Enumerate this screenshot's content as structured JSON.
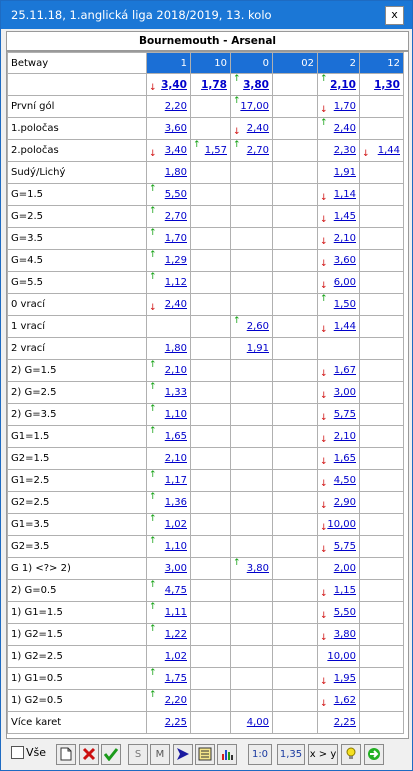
{
  "window": {
    "title": "25.11.18, 1.anglická liga 2018/2019, 13. kolo",
    "close_label": "x"
  },
  "match": "Bournemouth - Arsenal",
  "columns": [
    "1",
    "10",
    "0",
    "02",
    "2",
    "12"
  ],
  "header_label": "Betway",
  "colors": {
    "titlebar": "#1b77d6",
    "header_cell": "#1b6fd6",
    "link": "#0000cc",
    "up": "#10a010",
    "down": "#d01010"
  },
  "rows": [
    {
      "label": "",
      "main": true,
      "cells": [
        [
          "3,40",
          "dn"
        ],
        [
          "1,78",
          ""
        ],
        [
          "3,80",
          "up"
        ],
        [
          "",
          ""
        ],
        [
          "2,10",
          "up"
        ],
        [
          "1,30",
          ""
        ]
      ]
    },
    {
      "label": "První gól",
      "cells": [
        [
          "2,20",
          ""
        ],
        [
          "",
          ""
        ],
        [
          "17,00",
          "up"
        ],
        [
          "",
          ""
        ],
        [
          "1,70",
          "dn"
        ],
        [
          "",
          ""
        ]
      ]
    },
    {
      "label": "1.poločas",
      "cells": [
        [
          "3,60",
          ""
        ],
        [
          "",
          ""
        ],
        [
          "2,40",
          "dn"
        ],
        [
          "",
          ""
        ],
        [
          "2,40",
          "up"
        ],
        [
          "",
          ""
        ]
      ]
    },
    {
      "label": "2.poločas",
      "cells": [
        [
          "3,40",
          "dn"
        ],
        [
          "1,57",
          "up"
        ],
        [
          "2,70",
          "up"
        ],
        [
          "",
          ""
        ],
        [
          "2,30",
          ""
        ],
        [
          "1,44",
          "dn"
        ]
      ]
    },
    {
      "label": "Sudý/Lichý",
      "cells": [
        [
          "1,80",
          ""
        ],
        [
          "",
          ""
        ],
        [
          "",
          ""
        ],
        [
          "",
          ""
        ],
        [
          "1,91",
          ""
        ],
        [
          "",
          ""
        ]
      ]
    },
    {
      "label": "G=1.5",
      "cells": [
        [
          "5,50",
          "up"
        ],
        [
          "",
          ""
        ],
        [
          "",
          ""
        ],
        [
          "",
          ""
        ],
        [
          "1,14",
          "dn"
        ],
        [
          "",
          ""
        ]
      ]
    },
    {
      "label": "G=2.5",
      "cells": [
        [
          "2,70",
          "up"
        ],
        [
          "",
          ""
        ],
        [
          "",
          ""
        ],
        [
          "",
          ""
        ],
        [
          "1,45",
          "dn"
        ],
        [
          "",
          ""
        ]
      ]
    },
    {
      "label": "G=3.5",
      "cells": [
        [
          "1,70",
          "up"
        ],
        [
          "",
          ""
        ],
        [
          "",
          ""
        ],
        [
          "",
          ""
        ],
        [
          "2,10",
          "dn"
        ],
        [
          "",
          ""
        ]
      ]
    },
    {
      "label": "G=4.5",
      "cells": [
        [
          "1,29",
          "up"
        ],
        [
          "",
          ""
        ],
        [
          "",
          ""
        ],
        [
          "",
          ""
        ],
        [
          "3,60",
          "dn"
        ],
        [
          "",
          ""
        ]
      ]
    },
    {
      "label": "G=5.5",
      "cells": [
        [
          "1,12",
          "up"
        ],
        [
          "",
          ""
        ],
        [
          "",
          ""
        ],
        [
          "",
          ""
        ],
        [
          "6,00",
          "dn"
        ],
        [
          "",
          ""
        ]
      ]
    },
    {
      "label": "0 vrací",
      "cells": [
        [
          "2,40",
          "dn"
        ],
        [
          "",
          ""
        ],
        [
          "",
          ""
        ],
        [
          "",
          ""
        ],
        [
          "1,50",
          "up"
        ],
        [
          "",
          ""
        ]
      ]
    },
    {
      "label": "1 vrací",
      "cells": [
        [
          "",
          ""
        ],
        [
          "",
          ""
        ],
        [
          "2,60",
          "up"
        ],
        [
          "",
          ""
        ],
        [
          "1,44",
          "dn"
        ],
        [
          "",
          ""
        ]
      ]
    },
    {
      "label": "2 vrací",
      "cells": [
        [
          "1,80",
          ""
        ],
        [
          "",
          ""
        ],
        [
          "1,91",
          ""
        ],
        [
          "",
          ""
        ],
        [
          "",
          ""
        ],
        [
          "",
          ""
        ]
      ]
    },
    {
      "label": "2) G=1.5",
      "cells": [
        [
          "2,10",
          "up"
        ],
        [
          "",
          ""
        ],
        [
          "",
          ""
        ],
        [
          "",
          ""
        ],
        [
          "1,67",
          "dn"
        ],
        [
          "",
          ""
        ]
      ]
    },
    {
      "label": "2) G=2.5",
      "cells": [
        [
          "1,33",
          "up"
        ],
        [
          "",
          ""
        ],
        [
          "",
          ""
        ],
        [
          "",
          ""
        ],
        [
          "3,00",
          "dn"
        ],
        [
          "",
          ""
        ]
      ]
    },
    {
      "label": "2) G=3.5",
      "cells": [
        [
          "1,10",
          "up"
        ],
        [
          "",
          ""
        ],
        [
          "",
          ""
        ],
        [
          "",
          ""
        ],
        [
          "5,75",
          "dn"
        ],
        [
          "",
          ""
        ]
      ]
    },
    {
      "label": "G1=1.5",
      "cells": [
        [
          "1,65",
          "up"
        ],
        [
          "",
          ""
        ],
        [
          "",
          ""
        ],
        [
          "",
          ""
        ],
        [
          "2,10",
          "dn"
        ],
        [
          "",
          ""
        ]
      ]
    },
    {
      "label": "G2=1.5",
      "cells": [
        [
          "2,10",
          ""
        ],
        [
          "",
          ""
        ],
        [
          "",
          ""
        ],
        [
          "",
          ""
        ],
        [
          "1,65",
          "dn"
        ],
        [
          "",
          ""
        ]
      ]
    },
    {
      "label": "G1=2.5",
      "cells": [
        [
          "1,17",
          "up"
        ],
        [
          "",
          ""
        ],
        [
          "",
          ""
        ],
        [
          "",
          ""
        ],
        [
          "4,50",
          "dn"
        ],
        [
          "",
          ""
        ]
      ]
    },
    {
      "label": "G2=2.5",
      "cells": [
        [
          "1,36",
          "up"
        ],
        [
          "",
          ""
        ],
        [
          "",
          ""
        ],
        [
          "",
          ""
        ],
        [
          "2,90",
          "dn"
        ],
        [
          "",
          ""
        ]
      ]
    },
    {
      "label": "G1=3.5",
      "cells": [
        [
          "1,02",
          "up"
        ],
        [
          "",
          ""
        ],
        [
          "",
          ""
        ],
        [
          "",
          ""
        ],
        [
          "10,00",
          "dn"
        ],
        [
          "",
          ""
        ]
      ]
    },
    {
      "label": "G2=3.5",
      "cells": [
        [
          "1,10",
          "up"
        ],
        [
          "",
          ""
        ],
        [
          "",
          ""
        ],
        [
          "",
          ""
        ],
        [
          "5,75",
          "dn"
        ],
        [
          "",
          ""
        ]
      ]
    },
    {
      "label": "G 1) <?> 2)",
      "cells": [
        [
          "3,00",
          ""
        ],
        [
          "",
          ""
        ],
        [
          "3,80",
          "up"
        ],
        [
          "",
          ""
        ],
        [
          "2,00",
          ""
        ],
        [
          "",
          ""
        ]
      ]
    },
    {
      "label": "2) G=0.5",
      "cells": [
        [
          "4,75",
          "up"
        ],
        [
          "",
          ""
        ],
        [
          "",
          ""
        ],
        [
          "",
          ""
        ],
        [
          "1,15",
          "dn"
        ],
        [
          "",
          ""
        ]
      ]
    },
    {
      "label": "1) G1=1.5",
      "cells": [
        [
          "1,11",
          "up"
        ],
        [
          "",
          ""
        ],
        [
          "",
          ""
        ],
        [
          "",
          ""
        ],
        [
          "5,50",
          "dn"
        ],
        [
          "",
          ""
        ]
      ]
    },
    {
      "label": "1) G2=1.5",
      "cells": [
        [
          "1,22",
          "up"
        ],
        [
          "",
          ""
        ],
        [
          "",
          ""
        ],
        [
          "",
          ""
        ],
        [
          "3,80",
          "dn"
        ],
        [
          "",
          ""
        ]
      ]
    },
    {
      "label": "1) G2=2.5",
      "cells": [
        [
          "1,02",
          ""
        ],
        [
          "",
          ""
        ],
        [
          "",
          ""
        ],
        [
          "",
          ""
        ],
        [
          "10,00",
          ""
        ],
        [
          "",
          ""
        ]
      ]
    },
    {
      "label": "1) G1=0.5",
      "cells": [
        [
          "1,75",
          "up"
        ],
        [
          "",
          ""
        ],
        [
          "",
          ""
        ],
        [
          "",
          ""
        ],
        [
          "1,95",
          "dn"
        ],
        [
          "",
          ""
        ]
      ]
    },
    {
      "label": "1) G2=0.5",
      "cells": [
        [
          "2,20",
          "up"
        ],
        [
          "",
          ""
        ],
        [
          "",
          ""
        ],
        [
          "",
          ""
        ],
        [
          "1,62",
          "dn"
        ],
        [
          "",
          ""
        ]
      ]
    },
    {
      "label": "Více karet",
      "cells": [
        [
          "2,25",
          ""
        ],
        [
          "",
          ""
        ],
        [
          "4,00",
          ""
        ],
        [
          "",
          ""
        ],
        [
          "2,25",
          ""
        ],
        [
          "",
          ""
        ]
      ]
    }
  ],
  "toolbar": {
    "all_label": "Vše",
    "s_label": "S",
    "m_label": "M",
    "score_label": "1:0",
    "odds_label": "1,35",
    "compare_label": "x > y"
  }
}
